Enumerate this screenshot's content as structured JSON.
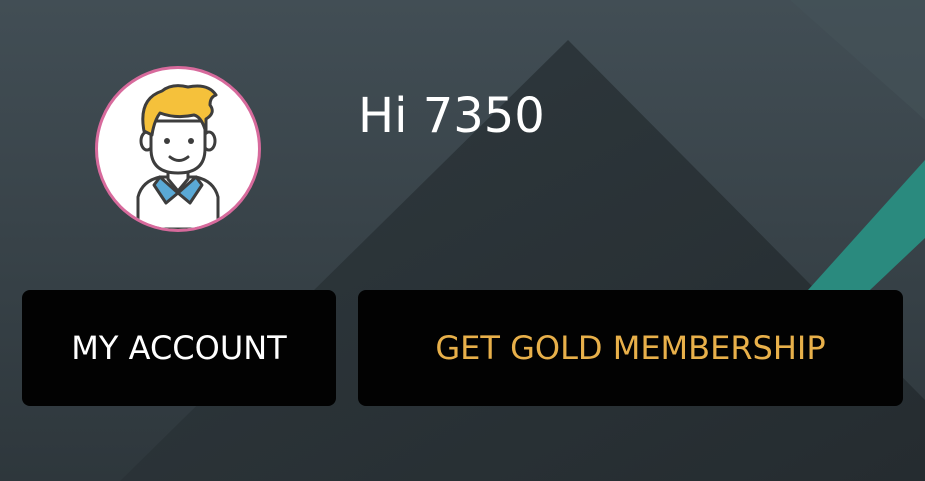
{
  "profile": {
    "greeting": "Hi 7350",
    "avatar_icon": "user-avatar-icon"
  },
  "actions": {
    "my_account_label": "MY ACCOUNT",
    "gold_membership_label": "GET GOLD MEMBERSHIP"
  },
  "colors": {
    "background": "#2b3338",
    "avatar_border": "#d76a9c",
    "button_bg": "#020202",
    "gold_text": "#e8b04a",
    "accent_stripe": "#2a8a7e"
  }
}
